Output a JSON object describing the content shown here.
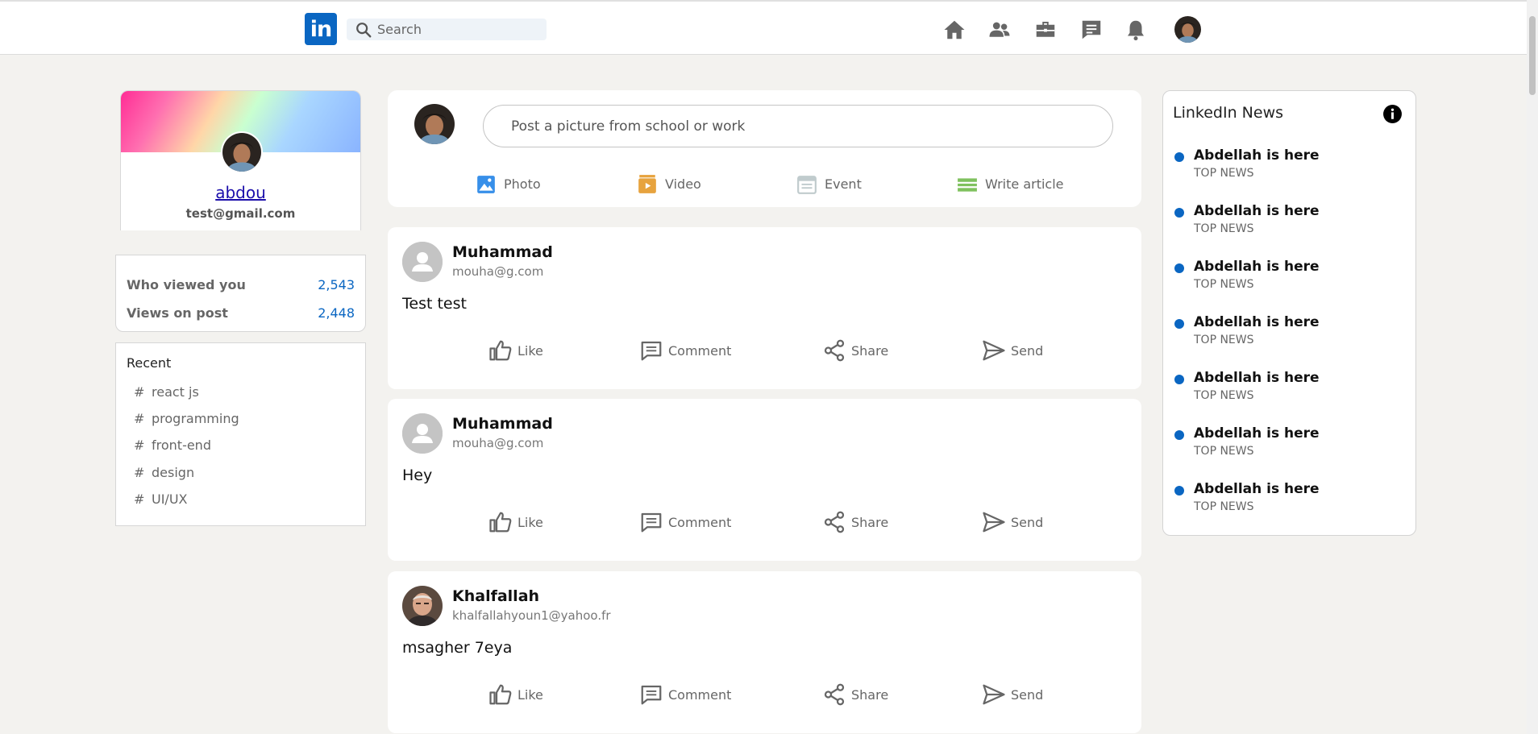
{
  "header": {
    "logo_text": "in",
    "search_placeholder": "Search",
    "nav_icons": [
      "home-icon",
      "network-icon",
      "jobs-icon",
      "messaging-icon",
      "notifications-icon"
    ]
  },
  "colors": {
    "brand": "#0a66c2",
    "photo": "#378fe9",
    "video": "#e7a33e",
    "event": "#c0cbcd",
    "article": "#7fc15e"
  },
  "profile": {
    "name": "abdou",
    "email": "test@gmail.com"
  },
  "stats": [
    {
      "label": "Who viewed you",
      "value": "2,543"
    },
    {
      "label": "Views on post",
      "value": "2,448"
    }
  ],
  "recent": {
    "title": "Recent",
    "items": [
      "react js",
      "programming",
      "front-end",
      "design",
      "UI/UX"
    ],
    "hash": "#"
  },
  "composer": {
    "placeholder": "Post a picture from school or work",
    "actions": [
      {
        "label": "Photo",
        "icon": "photo-icon"
      },
      {
        "label": "Video",
        "icon": "video-icon"
      },
      {
        "label": "Event",
        "icon": "event-icon"
      },
      {
        "label": "Write article",
        "icon": "article-icon"
      }
    ]
  },
  "posts": [
    {
      "name": "Muhammad",
      "email": "mouha@g.com",
      "text": "Test test"
    },
    {
      "name": "Muhammad",
      "email": "mouha@g.com",
      "text": "Hey"
    },
    {
      "name": "Khalfallah",
      "email": "khalfallahyoun1@yahoo.fr",
      "text": "msagher 7eya"
    }
  ],
  "post_actions": [
    "Like",
    "Comment",
    "Share",
    "Send"
  ],
  "news": {
    "title": "LinkedIn News",
    "items": [
      {
        "headline": "Abdellah is here",
        "sub": "TOP NEWS"
      },
      {
        "headline": "Abdellah is here",
        "sub": "TOP NEWS"
      },
      {
        "headline": "Abdellah is here",
        "sub": "TOP NEWS"
      },
      {
        "headline": "Abdellah is here",
        "sub": "TOP NEWS"
      },
      {
        "headline": "Abdellah is here",
        "sub": "TOP NEWS"
      },
      {
        "headline": "Abdellah is here",
        "sub": "TOP NEWS"
      },
      {
        "headline": "Abdellah is here",
        "sub": "TOP NEWS"
      }
    ]
  }
}
